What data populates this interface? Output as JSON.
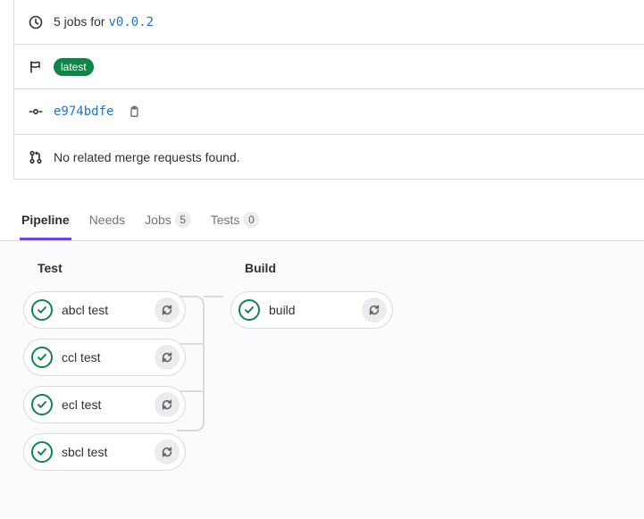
{
  "header": {
    "jobs_prefix": "5 jobs for ",
    "version": "v0.0.2",
    "latest_label": "latest",
    "commit_sha": "e974bdfe",
    "mr_text": "No related merge requests found."
  },
  "tabs": {
    "pipeline": "Pipeline",
    "needs": "Needs",
    "jobs": "Jobs",
    "jobs_count": "5",
    "tests": "Tests",
    "tests_count": "0"
  },
  "stages": {
    "test": {
      "title": "Test",
      "jobs": [
        {
          "name": "abcl test"
        },
        {
          "name": "ccl test"
        },
        {
          "name": "ecl test"
        },
        {
          "name": "sbcl test"
        }
      ]
    },
    "build": {
      "title": "Build",
      "jobs": [
        {
          "name": "build"
        }
      ]
    }
  }
}
